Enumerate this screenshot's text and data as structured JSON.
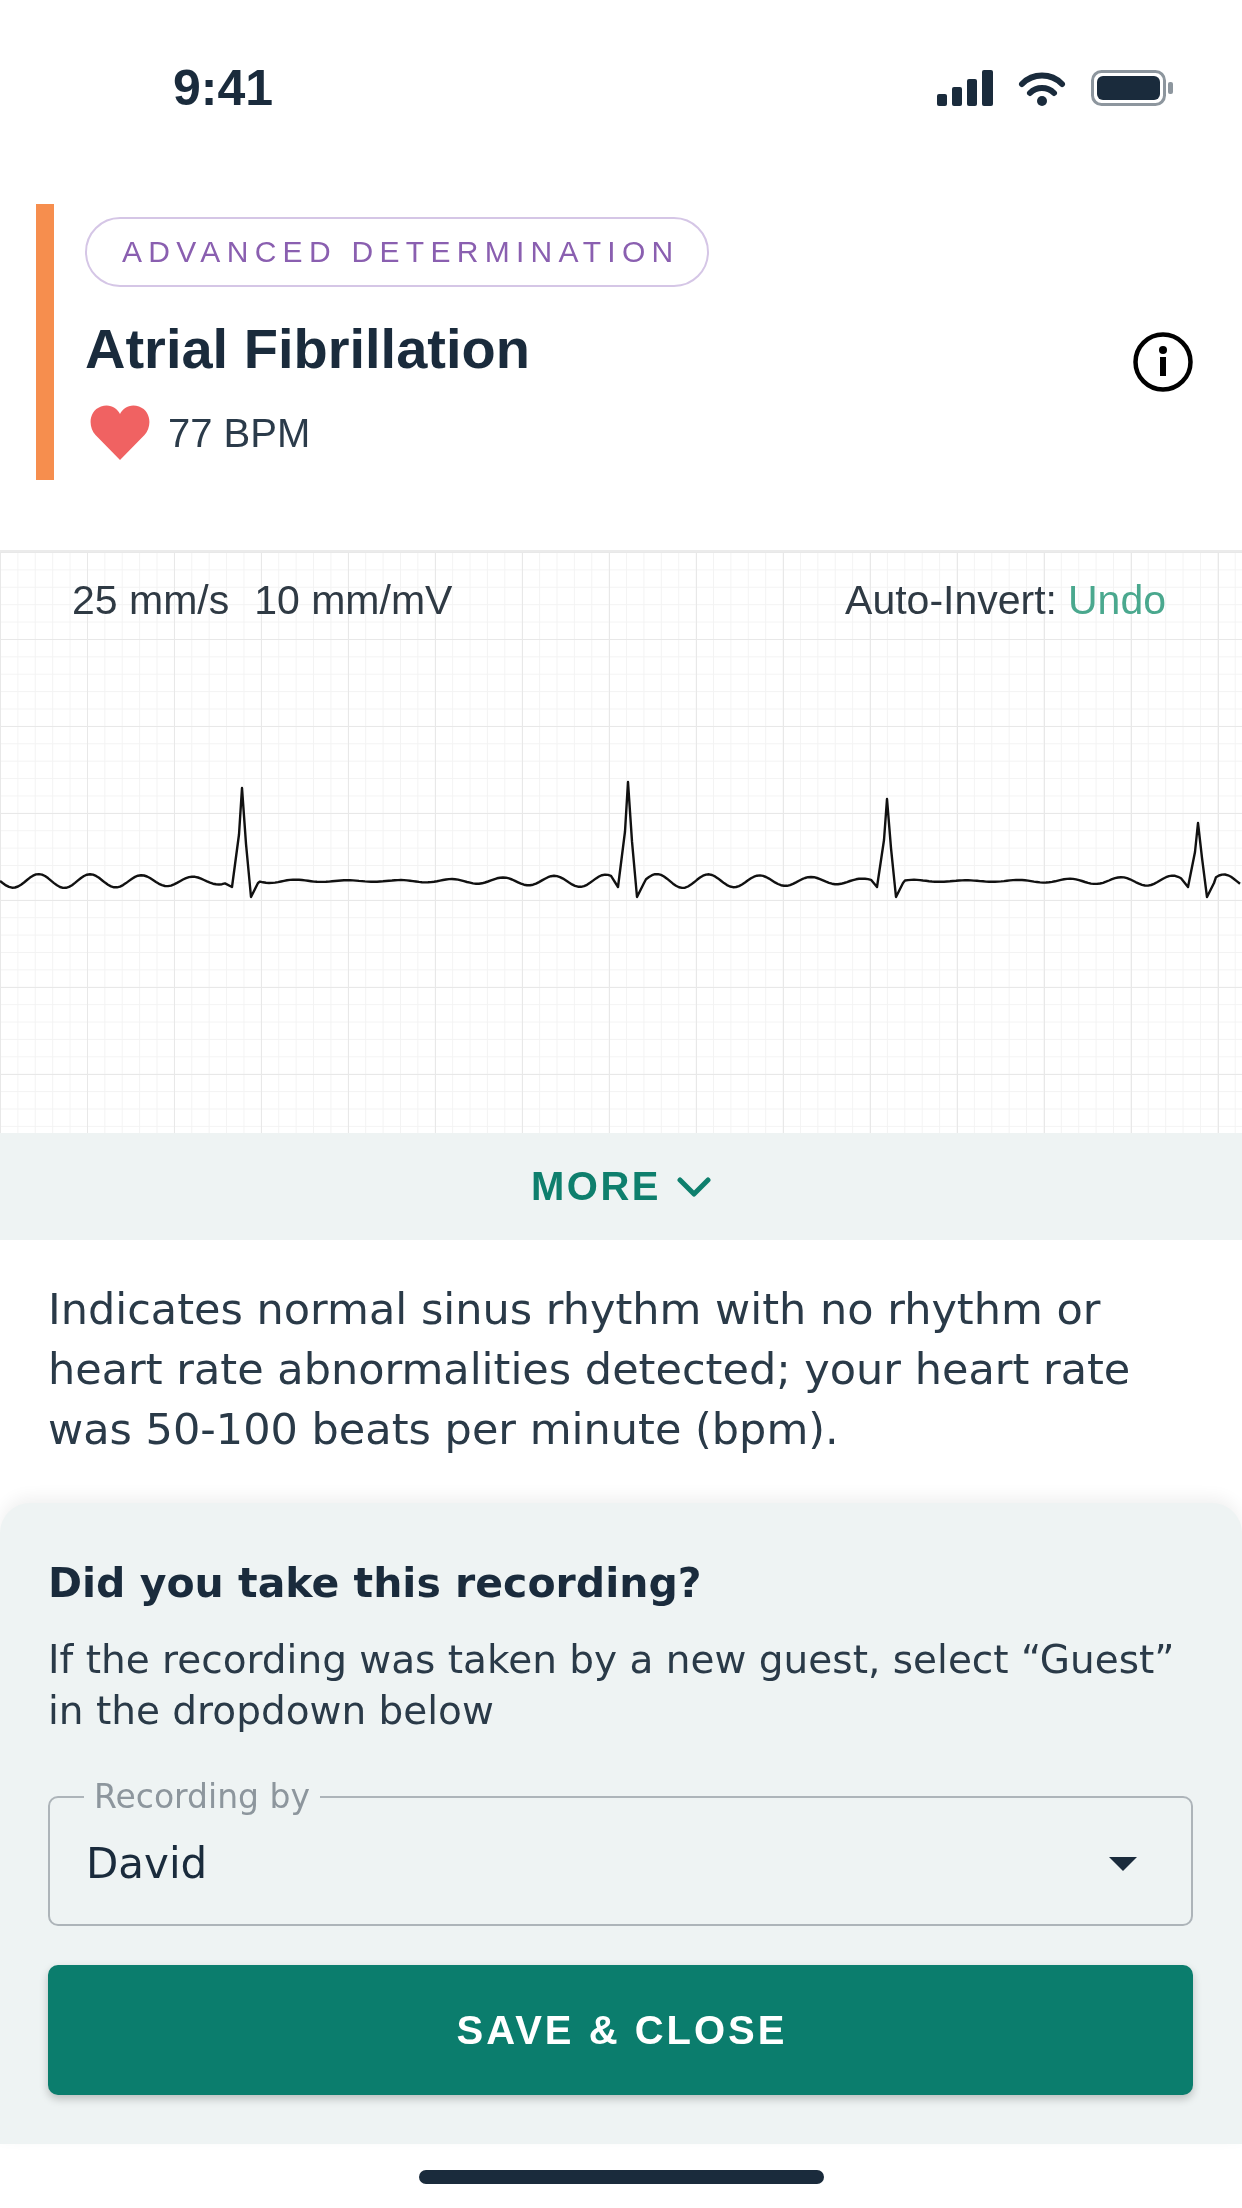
{
  "status_bar": {
    "time": "9:41"
  },
  "result": {
    "badge": "ADVANCED DETERMINATION",
    "title": "Atrial Fibrillation",
    "heart_rate": "77 BPM"
  },
  "ecg": {
    "paper_speed": "25 mm/s",
    "gain": "10 mm/mV",
    "auto_invert_label": "Auto-Invert:",
    "undo_link": "Undo"
  },
  "more_button": {
    "label": "MORE"
  },
  "description": "Indicates normal sinus rhythm with no rhythm or heart rate abnormalities detected; your heart rate was 50-100 beats per minute (bpm).",
  "recording_sheet": {
    "heading": "Did you take this recording?",
    "hint": "If the recording was taken by a new guest, select “Guest” in the dropdown below",
    "dropdown": {
      "label": "Recording by",
      "value": "David"
    },
    "save_button": "SAVE & CLOSE"
  }
}
